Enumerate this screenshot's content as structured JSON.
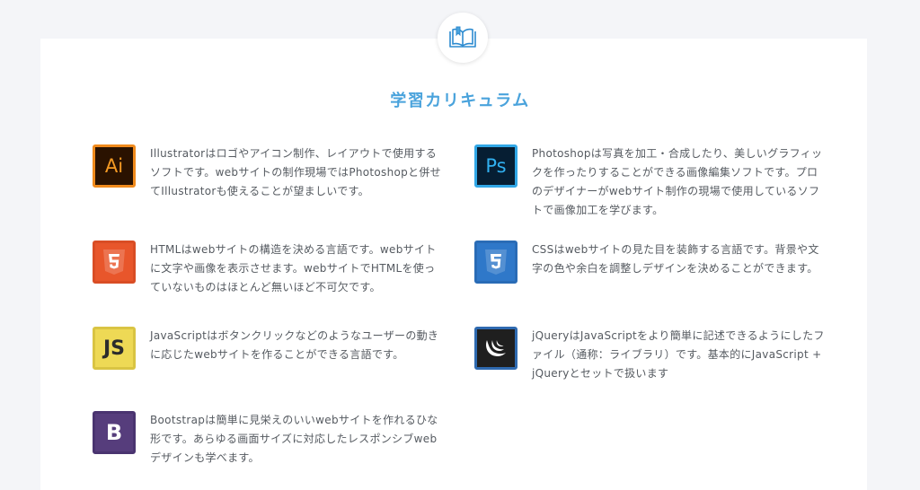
{
  "section": {
    "title": "学習カリキュラム",
    "badge_icon": "book-icon"
  },
  "items": [
    {
      "id": "illustrator",
      "logo_text": "Ai",
      "icon": "illustrator-icon",
      "description": "Illustratorはロゴやアイコン制作、レイアウトで使用するソフトです。webサイトの制作現場ではPhotoshopと併せてIllustratorも使えることが望ましいです。"
    },
    {
      "id": "photoshop",
      "logo_text": "Ps",
      "icon": "photoshop-icon",
      "description": "Photoshopは写真を加工・合成したり、美しいグラフィックを作ったりすることができる画像編集ソフトです。プロのデザイナーがwebサイト制作の現場で使用しているソフトで画像加工を学びます。"
    },
    {
      "id": "html",
      "logo_text": "",
      "icon": "html5-icon",
      "description": "HTMLはwebサイトの構造を決める言語です。webサイトに文字や画像を表示させます。webサイトでHTMLを使っていないものはほとんど無いほど不可欠です。"
    },
    {
      "id": "css",
      "logo_text": "",
      "icon": "css3-icon",
      "description": "CSSはwebサイトの見た目を装飾する言語です。背景や文字の色や余白を調整しデザインを決めることができます。"
    },
    {
      "id": "javascript",
      "logo_text": "JS",
      "icon": "javascript-icon",
      "description": "JavaScriptはボタンクリックなどのようなユーザーの動きに応じたwebサイトを作ることができる言語です。"
    },
    {
      "id": "jquery",
      "logo_text": "",
      "icon": "jquery-icon",
      "description": "jQueryはJavaScriptをより簡単に記述できるようにしたファイル（通称：ライブラリ）です。基本的にJavaScript + jQueryとセットで扱います"
    },
    {
      "id": "bootstrap",
      "logo_text": "B",
      "icon": "bootstrap-icon",
      "description": "Bootstrapは簡単に見栄えのいいwebサイトを作れるひな形です。あらゆる画面サイズに対応したレスポンシブwebデザインも学べます。"
    }
  ],
  "colors": {
    "accent": "#4aa3dc",
    "text": "#555a60",
    "background": "#f4f5f8",
    "panel": "#ffffff"
  }
}
